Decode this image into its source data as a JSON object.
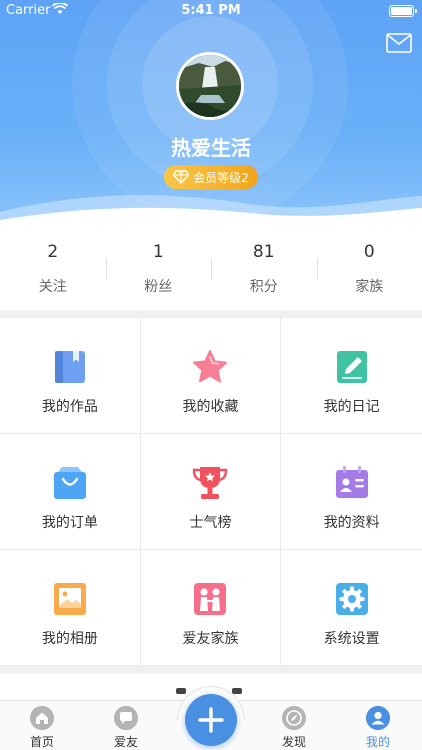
{
  "status_bar": {
    "carrier": "Carrier",
    "time": "5:41 PM"
  },
  "profile": {
    "name": "热爱生活",
    "level_badge": "会员等级2"
  },
  "stats": [
    {
      "value": "2",
      "label": "关注"
    },
    {
      "value": "1",
      "label": "粉丝"
    },
    {
      "value": "81",
      "label": "积分"
    },
    {
      "value": "0",
      "label": "家族"
    }
  ],
  "menu": [
    {
      "label": "我的作品",
      "icon": "book-icon",
      "color": "#6f9ff0"
    },
    {
      "label": "我的收藏",
      "icon": "star-icon",
      "color": "#f77f95"
    },
    {
      "label": "我的日记",
      "icon": "notebook-pencil-icon",
      "color": "#3fc3a3"
    },
    {
      "label": "我的订单",
      "icon": "shopping-bag-icon",
      "color": "#4ea4f5"
    },
    {
      "label": "士气榜",
      "icon": "trophy-icon",
      "color": "#f2525f"
    },
    {
      "label": "我的资料",
      "icon": "id-card-icon",
      "color": "#a57be8"
    },
    {
      "label": "我的相册",
      "icon": "photo-album-icon",
      "color": "#f8ab4a"
    },
    {
      "label": "爱友家族",
      "icon": "family-icon",
      "color": "#f56f89"
    },
    {
      "label": "系统设置",
      "icon": "gear-icon",
      "color": "#4aaee8"
    }
  ],
  "tabbar": [
    {
      "label": "首页",
      "icon": "home-icon",
      "active": false
    },
    {
      "label": "爱友",
      "icon": "chat-icon",
      "active": false
    },
    {
      "label": "",
      "icon": "plus-icon",
      "active": false
    },
    {
      "label": "发现",
      "icon": "compass-icon",
      "active": false
    },
    {
      "label": "我的",
      "icon": "user-icon",
      "active": true
    }
  ],
  "colors": {
    "header": "#5ea2f6",
    "accent": "#4a90e2",
    "badge": "#f5b42f"
  }
}
